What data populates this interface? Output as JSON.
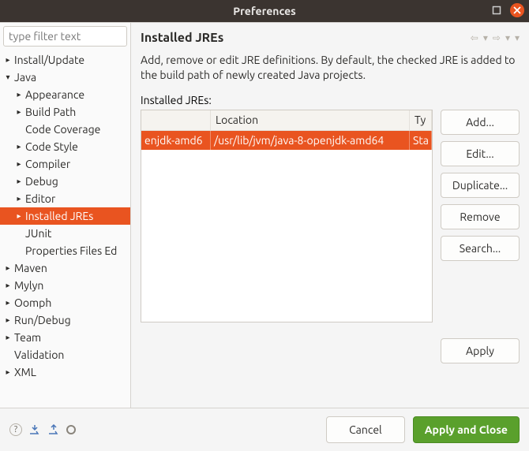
{
  "window": {
    "title": "Preferences"
  },
  "filter": {
    "placeholder": "type filter text"
  },
  "tree": [
    {
      "depth": 1,
      "expand": "▸",
      "label": "Install/Update"
    },
    {
      "depth": 1,
      "expand": "▾",
      "label": "Java"
    },
    {
      "depth": 2,
      "expand": "▸",
      "label": "Appearance"
    },
    {
      "depth": 2,
      "expand": "▸",
      "label": "Build Path"
    },
    {
      "depth": 2,
      "expand": "",
      "label": "Code Coverage"
    },
    {
      "depth": 2,
      "expand": "▸",
      "label": "Code Style"
    },
    {
      "depth": 2,
      "expand": "▸",
      "label": "Compiler"
    },
    {
      "depth": 2,
      "expand": "▸",
      "label": "Debug"
    },
    {
      "depth": 2,
      "expand": "▸",
      "label": "Editor"
    },
    {
      "depth": 2,
      "expand": "▸",
      "label": "Installed JREs",
      "selected": true
    },
    {
      "depth": 2,
      "expand": "",
      "label": "JUnit"
    },
    {
      "depth": 2,
      "expand": "",
      "label": "Properties Files Ed"
    },
    {
      "depth": 1,
      "expand": "▸",
      "label": "Maven"
    },
    {
      "depth": 1,
      "expand": "▸",
      "label": "Mylyn"
    },
    {
      "depth": 1,
      "expand": "▸",
      "label": "Oomph"
    },
    {
      "depth": 1,
      "expand": "▸",
      "label": "Run/Debug"
    },
    {
      "depth": 1,
      "expand": "▸",
      "label": "Team"
    },
    {
      "depth": 1,
      "expand": "",
      "label": "Validation"
    },
    {
      "depth": 1,
      "expand": "▸",
      "label": "XML"
    }
  ],
  "page": {
    "title": "Installed JREs",
    "description": "Add, remove or edit JRE definitions. By default, the checked JRE is added to the build path of newly created Java projects.",
    "table_label": "Installed JREs:",
    "columns": {
      "name": "",
      "location": "Location",
      "type": "Ty"
    },
    "rows": [
      {
        "name": "enjdk-amd6",
        "location": "/usr/lib/jvm/java-8-openjdk-amd64",
        "type": "Sta"
      }
    ],
    "buttons": {
      "add": "Add...",
      "edit": "Edit...",
      "duplicate": "Duplicate...",
      "remove": "Remove",
      "search": "Search..."
    },
    "apply": "Apply"
  },
  "footer": {
    "cancel": "Cancel",
    "applyclose": "Apply and Close"
  }
}
